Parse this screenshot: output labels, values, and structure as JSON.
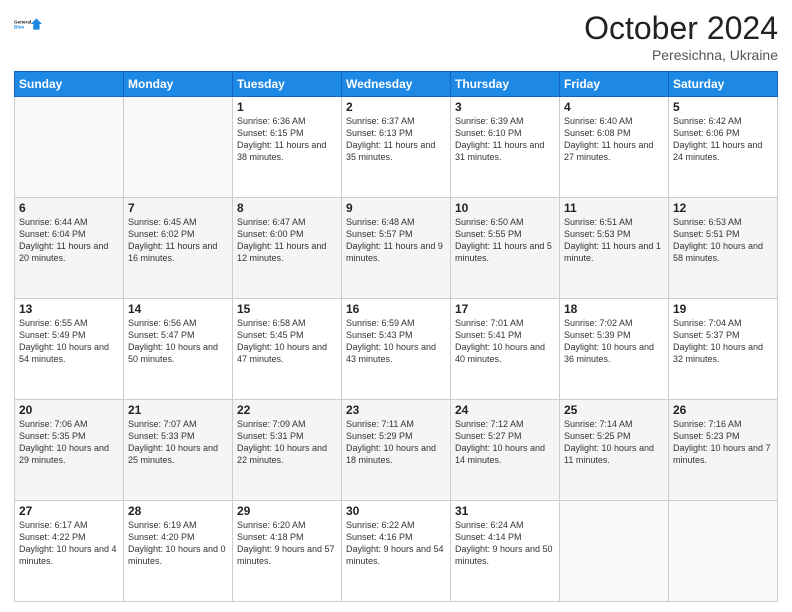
{
  "header": {
    "logo_general": "General",
    "logo_blue": "Blue",
    "month_title": "October 2024",
    "location": "Peresichna, Ukraine"
  },
  "weekdays": [
    "Sunday",
    "Monday",
    "Tuesday",
    "Wednesday",
    "Thursday",
    "Friday",
    "Saturday"
  ],
  "weeks": [
    [
      {
        "day": "",
        "info": ""
      },
      {
        "day": "",
        "info": ""
      },
      {
        "day": "1",
        "info": "Sunrise: 6:36 AM\nSunset: 6:15 PM\nDaylight: 11 hours and 38 minutes."
      },
      {
        "day": "2",
        "info": "Sunrise: 6:37 AM\nSunset: 6:13 PM\nDaylight: 11 hours and 35 minutes."
      },
      {
        "day": "3",
        "info": "Sunrise: 6:39 AM\nSunset: 6:10 PM\nDaylight: 11 hours and 31 minutes."
      },
      {
        "day": "4",
        "info": "Sunrise: 6:40 AM\nSunset: 6:08 PM\nDaylight: 11 hours and 27 minutes."
      },
      {
        "day": "5",
        "info": "Sunrise: 6:42 AM\nSunset: 6:06 PM\nDaylight: 11 hours and 24 minutes."
      }
    ],
    [
      {
        "day": "6",
        "info": "Sunrise: 6:44 AM\nSunset: 6:04 PM\nDaylight: 11 hours and 20 minutes."
      },
      {
        "day": "7",
        "info": "Sunrise: 6:45 AM\nSunset: 6:02 PM\nDaylight: 11 hours and 16 minutes."
      },
      {
        "day": "8",
        "info": "Sunrise: 6:47 AM\nSunset: 6:00 PM\nDaylight: 11 hours and 12 minutes."
      },
      {
        "day": "9",
        "info": "Sunrise: 6:48 AM\nSunset: 5:57 PM\nDaylight: 11 hours and 9 minutes."
      },
      {
        "day": "10",
        "info": "Sunrise: 6:50 AM\nSunset: 5:55 PM\nDaylight: 11 hours and 5 minutes."
      },
      {
        "day": "11",
        "info": "Sunrise: 6:51 AM\nSunset: 5:53 PM\nDaylight: 11 hours and 1 minute."
      },
      {
        "day": "12",
        "info": "Sunrise: 6:53 AM\nSunset: 5:51 PM\nDaylight: 10 hours and 58 minutes."
      }
    ],
    [
      {
        "day": "13",
        "info": "Sunrise: 6:55 AM\nSunset: 5:49 PM\nDaylight: 10 hours and 54 minutes."
      },
      {
        "day": "14",
        "info": "Sunrise: 6:56 AM\nSunset: 5:47 PM\nDaylight: 10 hours and 50 minutes."
      },
      {
        "day": "15",
        "info": "Sunrise: 6:58 AM\nSunset: 5:45 PM\nDaylight: 10 hours and 47 minutes."
      },
      {
        "day": "16",
        "info": "Sunrise: 6:59 AM\nSunset: 5:43 PM\nDaylight: 10 hours and 43 minutes."
      },
      {
        "day": "17",
        "info": "Sunrise: 7:01 AM\nSunset: 5:41 PM\nDaylight: 10 hours and 40 minutes."
      },
      {
        "day": "18",
        "info": "Sunrise: 7:02 AM\nSunset: 5:39 PM\nDaylight: 10 hours and 36 minutes."
      },
      {
        "day": "19",
        "info": "Sunrise: 7:04 AM\nSunset: 5:37 PM\nDaylight: 10 hours and 32 minutes."
      }
    ],
    [
      {
        "day": "20",
        "info": "Sunrise: 7:06 AM\nSunset: 5:35 PM\nDaylight: 10 hours and 29 minutes."
      },
      {
        "day": "21",
        "info": "Sunrise: 7:07 AM\nSunset: 5:33 PM\nDaylight: 10 hours and 25 minutes."
      },
      {
        "day": "22",
        "info": "Sunrise: 7:09 AM\nSunset: 5:31 PM\nDaylight: 10 hours and 22 minutes."
      },
      {
        "day": "23",
        "info": "Sunrise: 7:11 AM\nSunset: 5:29 PM\nDaylight: 10 hours and 18 minutes."
      },
      {
        "day": "24",
        "info": "Sunrise: 7:12 AM\nSunset: 5:27 PM\nDaylight: 10 hours and 14 minutes."
      },
      {
        "day": "25",
        "info": "Sunrise: 7:14 AM\nSunset: 5:25 PM\nDaylight: 10 hours and 11 minutes."
      },
      {
        "day": "26",
        "info": "Sunrise: 7:16 AM\nSunset: 5:23 PM\nDaylight: 10 hours and 7 minutes."
      }
    ],
    [
      {
        "day": "27",
        "info": "Sunrise: 6:17 AM\nSunset: 4:22 PM\nDaylight: 10 hours and 4 minutes."
      },
      {
        "day": "28",
        "info": "Sunrise: 6:19 AM\nSunset: 4:20 PM\nDaylight: 10 hours and 0 minutes."
      },
      {
        "day": "29",
        "info": "Sunrise: 6:20 AM\nSunset: 4:18 PM\nDaylight: 9 hours and 57 minutes."
      },
      {
        "day": "30",
        "info": "Sunrise: 6:22 AM\nSunset: 4:16 PM\nDaylight: 9 hours and 54 minutes."
      },
      {
        "day": "31",
        "info": "Sunrise: 6:24 AM\nSunset: 4:14 PM\nDaylight: 9 hours and 50 minutes."
      },
      {
        "day": "",
        "info": ""
      },
      {
        "day": "",
        "info": ""
      }
    ]
  ]
}
